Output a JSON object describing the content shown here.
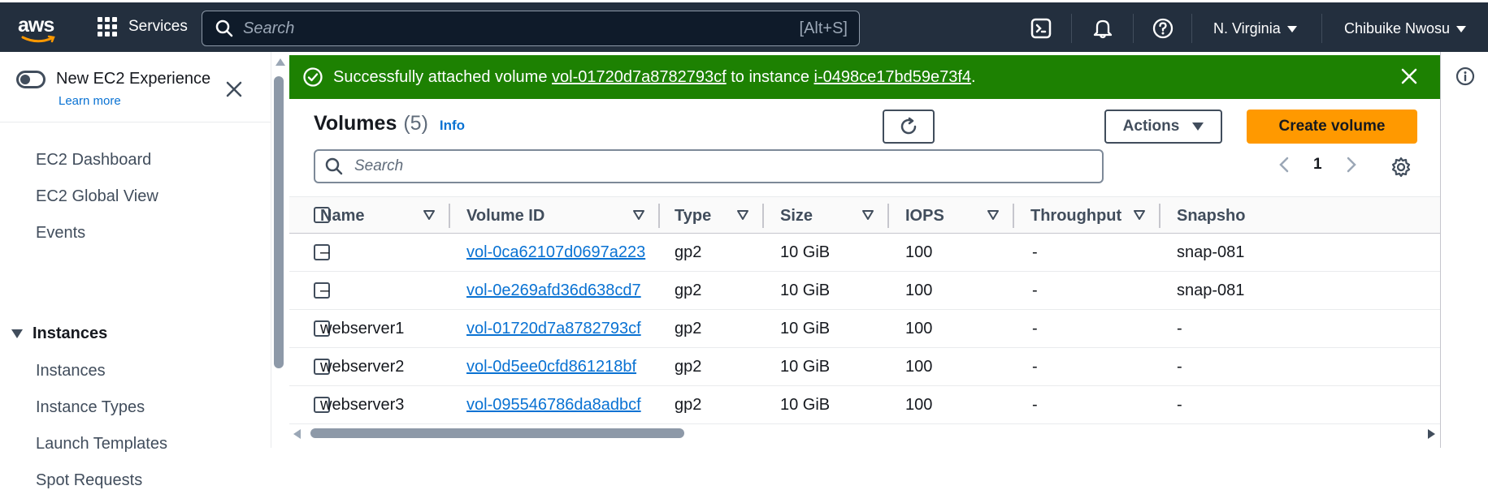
{
  "nav": {
    "logo_text": "aws",
    "services_label": "Services",
    "search_placeholder": "Search",
    "search_shortcut": "[Alt+S]",
    "region": "N. Virginia",
    "user": "Chibuike Nwosu",
    "icons": [
      "grid-icon",
      "cloudshell-icon",
      "notifications-icon",
      "help-icon"
    ]
  },
  "sidebar": {
    "toggle_label": "New EC2 Experience",
    "learn_more": "Learn more",
    "items": [
      "EC2 Dashboard",
      "EC2 Global View",
      "Events"
    ],
    "section_instances": "Instances",
    "instance_items": [
      "Instances",
      "Instance Types",
      "Launch Templates",
      "Spot Requests"
    ]
  },
  "flash": {
    "prefix": "Successfully attached volume",
    "volume_link": "vol-01720d7a8782793cf",
    "middle": "to instance",
    "instance_link": "i-0498ce17bd59e73f4",
    "suffix": ".",
    "color": "#1d8102"
  },
  "panel": {
    "title": "Volumes",
    "count": "(5)",
    "info": "Info",
    "actions_label": "Actions",
    "create_label": "Create volume",
    "search_placeholder": "Search",
    "page": "1",
    "accent": "#ff9900"
  },
  "table": {
    "columns": [
      "Name",
      "Volume ID",
      "Type",
      "Size",
      "IOPS",
      "Throughput",
      "Snapsho"
    ],
    "rows": [
      {
        "name": "–",
        "volume_id": "vol-0ca62107d0697a223",
        "type": "gp2",
        "size": "10 GiB",
        "iops": "100",
        "throughput": "-",
        "snapshot": "snap-081"
      },
      {
        "name": "–",
        "volume_id": "vol-0e269afd36d638cd7",
        "type": "gp2",
        "size": "10 GiB",
        "iops": "100",
        "throughput": "-",
        "snapshot": "snap-081"
      },
      {
        "name": "webserver1",
        "volume_id": "vol-01720d7a8782793cf",
        "type": "gp2",
        "size": "10 GiB",
        "iops": "100",
        "throughput": "-",
        "snapshot": "-"
      },
      {
        "name": "webserver2",
        "volume_id": "vol-0d5ee0cfd861218bf",
        "type": "gp2",
        "size": "10 GiB",
        "iops": "100",
        "throughput": "-",
        "snapshot": "-"
      },
      {
        "name": "webserver3",
        "volume_id": "vol-095546786da8adbcf",
        "type": "gp2",
        "size": "10 GiB",
        "iops": "100",
        "throughput": "-",
        "snapshot": "-"
      }
    ]
  }
}
